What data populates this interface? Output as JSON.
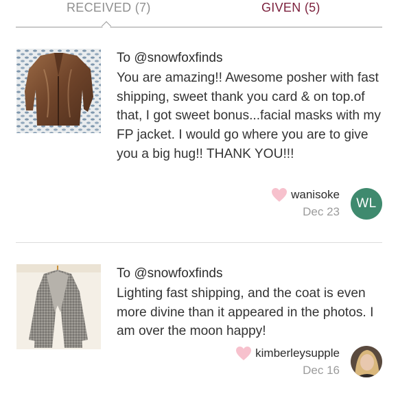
{
  "tabs": {
    "received_label": "RECEIVED (7)",
    "given_label": "GIVEN (5)"
  },
  "reviews": [
    {
      "to": "To @snowfoxfinds",
      "comment": "You are amazing!! Awesome posher with fast shipping, sweet thank you card & on top.of that, I got sweet bonus...facial masks with my FP jacket. I would go where you are to give you a big hug!! THANK YOU!!!",
      "username": "wanisoke",
      "date": "Dec 23",
      "avatar_initials": "WL",
      "avatar_color": "#3f8a6e",
      "thumbnail_icon": "brown-leather-jacket-photo"
    },
    {
      "to": "To @snowfoxfinds",
      "comment": "Lighting fast shipping, and the coat is even more divine than it appeared in the photos. I am over the moon happy!",
      "username": "kimberleysupple",
      "date": "Dec 16",
      "avatar_icon": "user-photo-avatar",
      "thumbnail_icon": "gray-wool-coat-photo"
    }
  ],
  "colors": {
    "given_tab": "#7b1f3b",
    "heart": "#f7c1cd",
    "muted_text": "#9b9b9b"
  }
}
